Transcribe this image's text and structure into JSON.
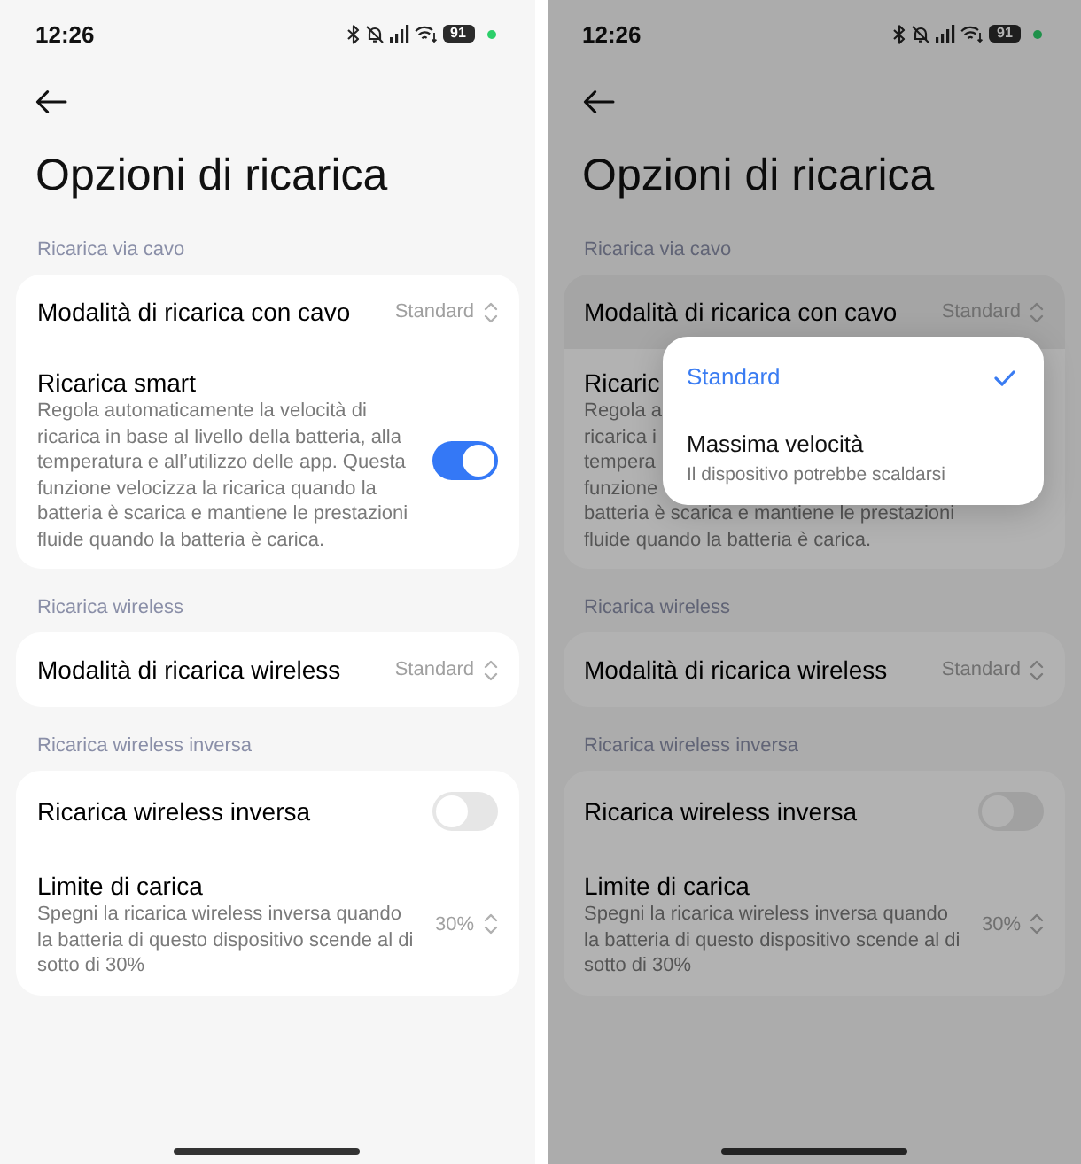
{
  "screens": [
    {
      "status_bar": {
        "time": "12:26",
        "battery": "91"
      },
      "title": "Opzioni di ricarica",
      "dimmed": false,
      "sections": [
        {
          "header": "Ricarica via cavo",
          "items": [
            {
              "kind": "select",
              "label": "Modalità di ricarica con cavo",
              "value": "Standard",
              "highlighted": false
            },
            {
              "kind": "toggle",
              "label": "Ricarica smart",
              "description": "Regola automaticamente la velocità di ricarica in base al livello della batteria, alla temperatura e all’utilizzo delle app. Questa funzione velocizza la ricarica quando la batteria è scarica e mantiene le prestazioni fluide quando la batteria è carica.",
              "on": true,
              "highlighted": false
            }
          ]
        },
        {
          "header": "Ricarica wireless",
          "items": [
            {
              "kind": "select",
              "label": "Modalità di ricarica wireless",
              "value": "Standard",
              "highlighted": false
            }
          ]
        },
        {
          "header": "Ricarica wireless inversa",
          "items": [
            {
              "kind": "toggle",
              "label": "Ricarica wireless inversa",
              "on": false,
              "highlighted": false
            },
            {
              "kind": "select",
              "label": "Limite di carica",
              "description": "Spegni la ricarica wireless inversa quando la batteria di questo dispositivo scende al di sotto di 30%",
              "value": "30%",
              "highlighted": false
            }
          ]
        }
      ]
    },
    {
      "status_bar": {
        "time": "12:26",
        "battery": "91"
      },
      "title": "Opzioni di ricarica",
      "dimmed": true,
      "sections": [
        {
          "header": "Ricarica via cavo",
          "items": [
            {
              "kind": "select",
              "label": "Modalità di ricarica con cavo",
              "value": "Standard",
              "highlighted": true
            },
            {
              "kind": "partial",
              "label": "Ricaric",
              "description_lines": [
                "Regola a",
                "ricarica i",
                "tempera",
                "funzione",
                "batteria è scarica e mantiene le prestazioni",
                "fluide quando la batteria è carica."
              ],
              "highlighted": false
            }
          ]
        },
        {
          "header": "Ricarica wireless",
          "items": [
            {
              "kind": "select",
              "label": "Modalità di ricarica wireless",
              "value": "Standard",
              "highlighted": false
            }
          ]
        },
        {
          "header": "Ricarica wireless inversa",
          "items": [
            {
              "kind": "toggle",
              "label": "Ricarica wireless inversa",
              "on": false,
              "highlighted": false
            },
            {
              "kind": "select",
              "label": "Limite di carica",
              "description": "Spegni la ricarica wireless inversa quando la batteria di questo dispositivo scende al di sotto di 30%",
              "value": "30%",
              "highlighted": false
            }
          ]
        }
      ],
      "popup": {
        "options": [
          {
            "label": "Standard",
            "selected": true
          },
          {
            "label": "Massima velocità",
            "description": "Il dispositivo potrebbe scaldarsi",
            "selected": false
          }
        ]
      }
    }
  ]
}
